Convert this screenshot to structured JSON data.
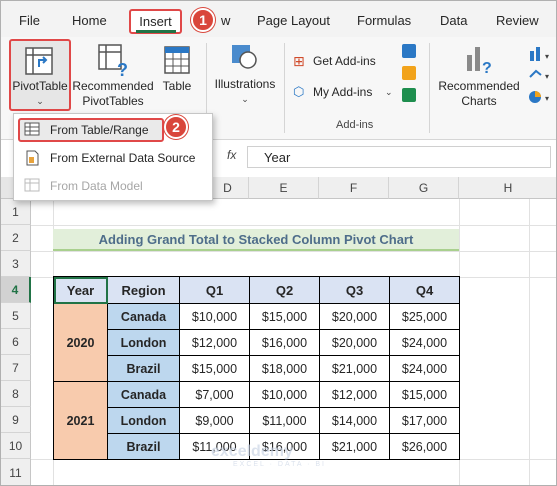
{
  "menu": {
    "tabs": [
      "File",
      "Home",
      "Insert",
      "w",
      "Page Layout",
      "Formulas",
      "Data",
      "Review"
    ],
    "active_tab": "Insert",
    "badge_1": "1",
    "badge_2": "2"
  },
  "ribbon": {
    "pivot_table": "PivotTable",
    "recommended_pivottables_1": "Recommended",
    "recommended_pivottables_2": "PivotTables",
    "table": "Table",
    "illustrations": "Illustrations",
    "get_addins": "Get Add-ins",
    "my_addins": "My Add-ins",
    "addins_group": "Add-ins",
    "recommended_charts_1": "Recommended",
    "recommended_charts_2": "Charts"
  },
  "dropdown": {
    "items": [
      {
        "label": "From Table/Range",
        "enabled": true
      },
      {
        "label": "From External Data Source",
        "enabled": true
      },
      {
        "label": "From Data Model",
        "enabled": false
      }
    ]
  },
  "formula_bar": {
    "fx": "fx",
    "value": "Year"
  },
  "grid": {
    "columns": [
      "D",
      "E",
      "F",
      "G",
      "H"
    ],
    "rows": [
      "1",
      "2",
      "3",
      "4",
      "5",
      "6",
      "7",
      "8",
      "9",
      "10",
      "11"
    ]
  },
  "sheet": {
    "title": "Adding Grand Total to Stacked Column Pivot Chart",
    "headers": [
      "Year",
      "Region",
      "Q1",
      "Q2",
      "Q3",
      "Q4"
    ],
    "groups": [
      {
        "year": "2020",
        "rows": [
          {
            "region": "Canada",
            "values": [
              "$10,000",
              "$15,000",
              "$20,000",
              "$25,000"
            ]
          },
          {
            "region": "London",
            "values": [
              "$12,000",
              "$16,000",
              "$20,000",
              "$24,000"
            ]
          },
          {
            "region": "Brazil",
            "values": [
              "$15,000",
              "$18,000",
              "$21,000",
              "$24,000"
            ]
          }
        ]
      },
      {
        "year": "2021",
        "rows": [
          {
            "region": "Canada",
            "values": [
              "$7,000",
              "$10,000",
              "$12,000",
              "$15,000"
            ]
          },
          {
            "region": "London",
            "values": [
              "$9,000",
              "$11,000",
              "$14,000",
              "$17,000"
            ]
          },
          {
            "region": "Brazil",
            "values": [
              "$11,000",
              "$16,000",
              "$21,000",
              "$26,000"
            ]
          }
        ]
      }
    ]
  },
  "watermark": {
    "name": "exceldemy",
    "tagline": "EXCEL · DATA · BI"
  }
}
